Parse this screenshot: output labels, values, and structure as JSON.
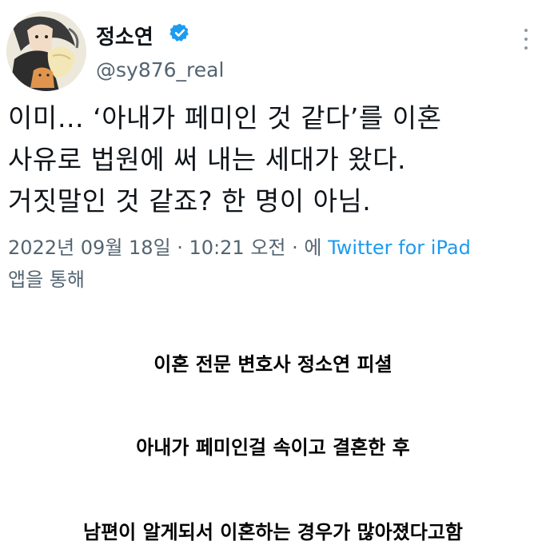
{
  "tweet": {
    "author": {
      "display_name": "정소연",
      "handle": "@sy876_real",
      "verified": true,
      "avatar_icon": "profile-avatar-illustration"
    },
    "more_icon": "vertical-ellipsis-icon",
    "text_lines": [
      "이미… ‘아내가 페미인 것 같다’를 이혼",
      "사유로 법원에 써 내는 세대가 왔다.",
      "거짓말인 것 같죠? 한 명이 아님."
    ],
    "meta": {
      "timestamp": "2022년 09월 18일 · 10:21 오전 · 에",
      "source": "Twitter for iPad",
      "suffix": "앱을 통해"
    },
    "colors": {
      "link": "#1d9bf0",
      "verified": "#1d9bf0",
      "secondary_text": "#536471"
    }
  },
  "captions": [
    "이혼 전문 변호사 정소연 피셜",
    "아내가 페미인걸 속이고 결혼한 후",
    "남편이 알게되서 이혼하는 경우가 많아졌다고함"
  ]
}
